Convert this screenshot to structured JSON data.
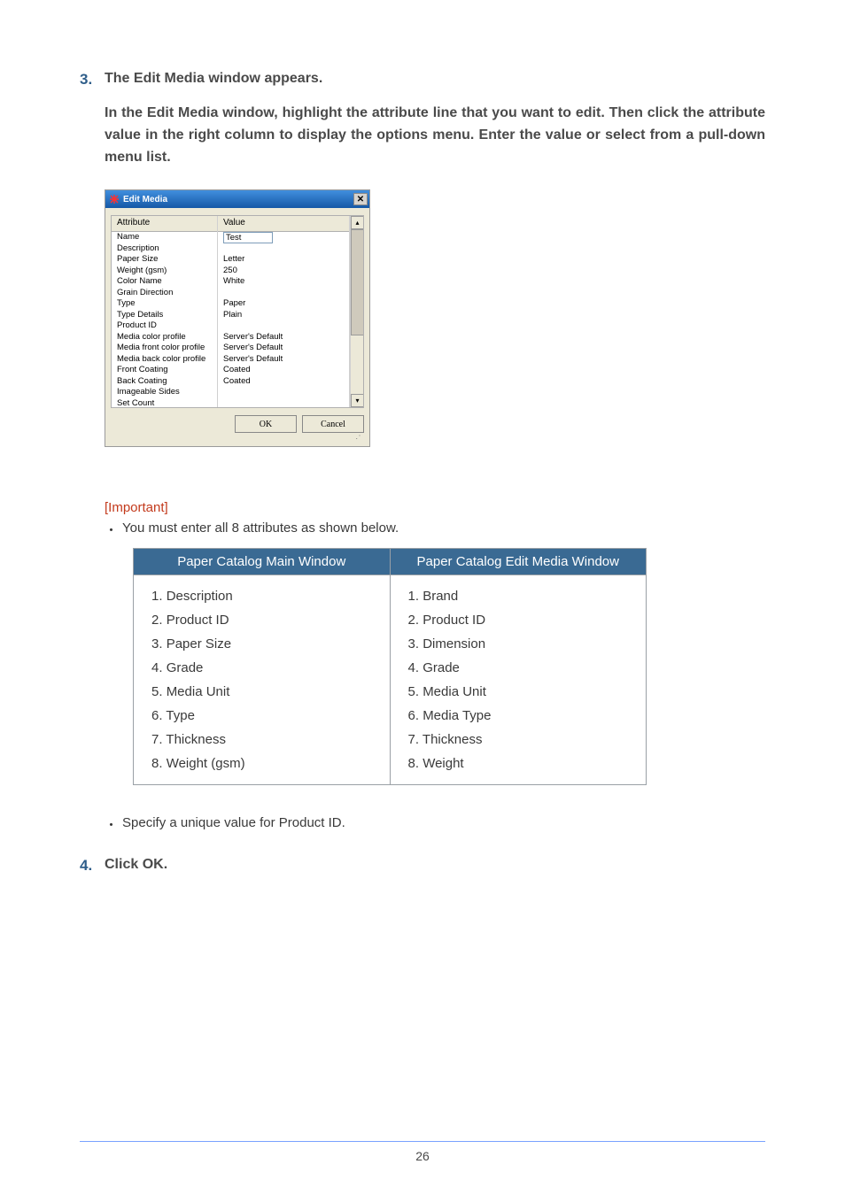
{
  "step3": {
    "number": "3",
    "title": "The Edit Media window appears.",
    "body": "In the Edit Media window, highlight the attribute line that you want to edit. Then click the attribute value in the right column to display the options menu.  Enter the value or select from a pull-down menu list."
  },
  "dialog": {
    "title": "Edit Media",
    "header_attr": "Attribute",
    "header_val": "Value",
    "name_input": "Test",
    "rows": [
      {
        "label": "Name",
        "value": ""
      },
      {
        "label": "Description",
        "value": ""
      },
      {
        "label": "Paper Size",
        "value": "Letter"
      },
      {
        "label": "Weight (gsm)",
        "value": "250"
      },
      {
        "label": "Color Name",
        "value": "White"
      },
      {
        "label": "Grain Direction",
        "value": ""
      },
      {
        "label": "Type",
        "value": "Paper"
      },
      {
        "label": "Type Details",
        "value": "Plain"
      },
      {
        "label": "Product ID",
        "value": ""
      },
      {
        "label": "Media color profile",
        "value": "Server's Default"
      },
      {
        "label": "Media front color profile",
        "value": "Server's Default"
      },
      {
        "label": "Media back color profile",
        "value": "Server's Default"
      },
      {
        "label": "Front Coating",
        "value": "Coated"
      },
      {
        "label": "Back Coating",
        "value": "Coated"
      },
      {
        "label": "Imageable Sides",
        "value": ""
      },
      {
        "label": "Set Count",
        "value": ""
      }
    ],
    "ok": "OK",
    "cancel": "Cancel"
  },
  "important": {
    "label": "[Important]",
    "bullet1": "You must enter all 8 attributes as shown below.",
    "bullet2": "Specify a unique value for Product ID."
  },
  "attr_table": {
    "head_left": "Paper Catalog Main Window",
    "head_right": "Paper Catalog Edit Media Window",
    "left": [
      "Description",
      "Product ID",
      "Paper Size",
      "Grade",
      "Media Unit",
      "Type",
      "Thickness",
      "Weight (gsm)"
    ],
    "right": [
      "Brand",
      "Product ID",
      "Dimension",
      "Grade",
      "Media Unit",
      "Media Type",
      "Thickness",
      "Weight"
    ]
  },
  "step4": {
    "number": "4",
    "title": "Click OK."
  },
  "page_number": "26"
}
